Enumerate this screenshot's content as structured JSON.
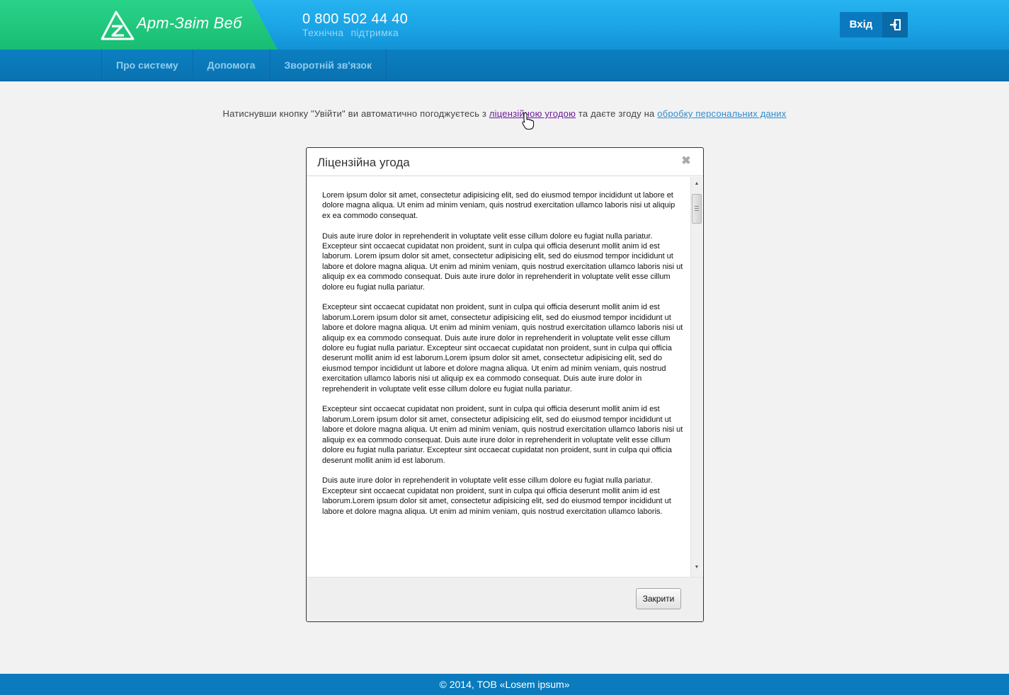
{
  "header": {
    "logo_text": "Арт-Звіт Веб",
    "phone": "0 800 502 44 40",
    "support": "Технічна підтримка",
    "login_label": "Вхід"
  },
  "nav": {
    "items": [
      {
        "label": "Про систему"
      },
      {
        "label": "Допомога"
      },
      {
        "label": "Зворотній зв'язок"
      }
    ]
  },
  "notice": {
    "text_before": "Натиснувши кнопку \"Увійти\" ви автоматично погоджуєтесь з ",
    "license_link": "ліцензійною угодою",
    "text_middle": " та даєте згоду на ",
    "privacy_link": "обробку персональних даних"
  },
  "modal": {
    "title": "Ліцензійна угода",
    "close_icon": "✖",
    "paragraphs": [
      "Lorem ipsum dolor sit amet, consectetur adipisicing elit, sed do eiusmod tempor incididunt ut labore et dolore magna aliqua. Ut enim ad minim veniam, quis nostrud exercitation ullamco laboris nisi ut aliquip ex ea commodo consequat.",
      "Duis aute irure dolor in reprehenderit in voluptate velit esse cillum dolore eu fugiat nulla pariatur. Excepteur sint occaecat cupidatat non proident, sunt in culpa qui officia deserunt mollit anim id est laborum. Lorem ipsum dolor sit amet, consectetur adipisicing elit, sed do eiusmod tempor incididunt ut labore et dolore magna aliqua. Ut enim ad minim veniam, quis nostrud exercitation ullamco laboris nisi ut aliquip ex ea commodo consequat. Duis aute irure dolor in reprehenderit in voluptate velit esse cillum dolore eu fugiat nulla pariatur.",
      "Excepteur sint occaecat cupidatat non proident, sunt in culpa qui officia deserunt mollit anim id est laborum.Lorem ipsum dolor sit amet, consectetur adipisicing elit, sed do eiusmod tempor incididunt ut labore et dolore magna aliqua. Ut enim ad minim veniam, quis nostrud exercitation ullamco laboris nisi ut aliquip ex ea commodo consequat. Duis aute irure dolor in reprehenderit in voluptate velit esse cillum dolore eu fugiat nulla pariatur. Excepteur sint occaecat cupidatat non proident, sunt in culpa qui officia deserunt mollit anim id est laborum.Lorem ipsum dolor sit amet, consectetur adipisicing elit, sed do eiusmod tempor incididunt ut labore et dolore magna aliqua. Ut enim ad minim veniam, quis nostrud exercitation ullamco laboris nisi ut aliquip ex ea commodo consequat. Duis aute irure dolor in reprehenderit in voluptate velit esse cillum dolore eu fugiat nulla pariatur.",
      "Excepteur sint occaecat cupidatat non proident, sunt in culpa qui officia deserunt mollit anim id est laborum.Lorem ipsum dolor sit amet, consectetur adipisicing elit, sed do eiusmod tempor incididunt ut labore et dolore magna aliqua. Ut enim ad minim veniam, quis nostrud exercitation ullamco laboris nisi ut aliquip ex ea commodo consequat. Duis aute irure dolor in reprehenderit in voluptate velit esse cillum dolore eu fugiat nulla pariatur. Excepteur sint occaecat cupidatat non proident, sunt in culpa qui officia deserunt mollit anim id est laborum.",
      "Duis aute irure dolor in reprehenderit in voluptate velit esse cillum dolore eu fugiat nulla pariatur. Excepteur sint occaecat cupidatat non proident, sunt in culpa qui officia deserunt mollit anim id est laborum.Lorem ipsum dolor sit amet, consectetur adipisicing elit, sed do eiusmod tempor incididunt ut labore et dolore magna aliqua. Ut enim ad minim veniam, quis nostrud exercitation ullamco laboris."
    ],
    "close_button": "Закрити"
  },
  "footer": {
    "copyright": "© 2014, ТОВ «Losem ipsum»"
  },
  "icons": {
    "logo": "logo-triangle-icon",
    "login": "sign-in-icon",
    "cursor": "hand-pointer-icon"
  },
  "colors": {
    "header_blue": "#1aa4e6",
    "logo_green": "#18bd72",
    "nav_blue": "#0b7fc1",
    "footer_blue": "#0b7bbd",
    "visited_link": "#6a1b9a",
    "link_blue": "#2f8ccc"
  }
}
